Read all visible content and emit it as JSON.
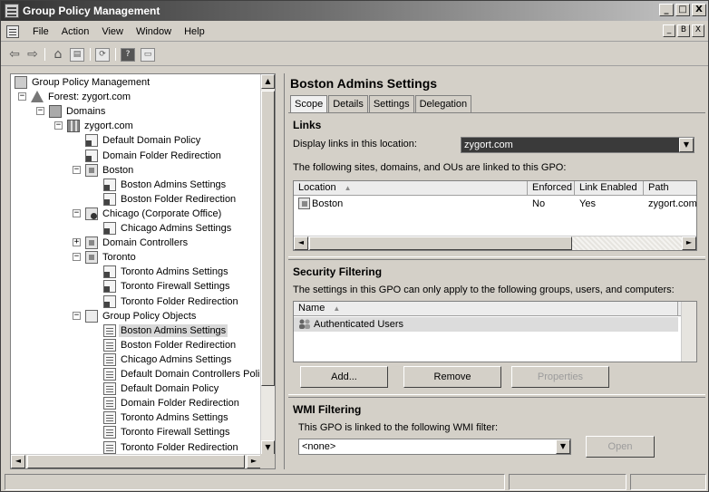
{
  "window": {
    "title": "Group Policy Management",
    "controls": [
      "_",
      "□",
      "X"
    ]
  },
  "menubar": {
    "items": [
      "File",
      "Action",
      "View",
      "Window",
      "Help"
    ],
    "mdi_controls": [
      "_",
      "B",
      "X"
    ]
  },
  "toolbar": {
    "buttons": [
      {
        "name": "back-icon",
        "glyph": "⇦"
      },
      {
        "name": "forward-icon",
        "glyph": "⇨"
      },
      {
        "name": "up-folder-icon",
        "glyph": "⌂"
      },
      {
        "name": "show-hide-tree-icon",
        "glyph": "▤"
      },
      {
        "name": "refresh-icon",
        "glyph": "⟳"
      },
      {
        "name": "help-icon",
        "glyph": "?"
      },
      {
        "name": "properties-icon",
        "glyph": "▭"
      }
    ]
  },
  "tree": {
    "nodes": [
      {
        "label": "Group Policy Management",
        "icon": "gpm",
        "level": 0,
        "expander": ""
      },
      {
        "label": "Forest: zygort.com",
        "icon": "forest",
        "level": 1,
        "expander": "−"
      },
      {
        "label": "Domains",
        "icon": "domains",
        "level": 2,
        "expander": "−"
      },
      {
        "label": "zygort.com",
        "icon": "domain",
        "level": 3,
        "expander": "−"
      },
      {
        "label": "Default Domain Policy",
        "icon": "link",
        "level": 4,
        "expander": ""
      },
      {
        "label": "Domain Folder Redirection",
        "icon": "link",
        "level": 4,
        "expander": ""
      },
      {
        "label": "Boston",
        "icon": "ou",
        "level": 4,
        "expander": "−"
      },
      {
        "label": "Boston Admins Settings",
        "icon": "link",
        "level": 5,
        "expander": ""
      },
      {
        "label": "Boston Folder Redirection",
        "icon": "link",
        "level": 5,
        "expander": ""
      },
      {
        "label": "Chicago (Corporate Office)",
        "icon": "ou-warn",
        "level": 4,
        "expander": "−"
      },
      {
        "label": "Chicago Admins Settings",
        "icon": "link",
        "level": 5,
        "expander": ""
      },
      {
        "label": "Domain Controllers",
        "icon": "ou",
        "level": 4,
        "expander": "+"
      },
      {
        "label": "Toronto",
        "icon": "ou",
        "level": 4,
        "expander": "−"
      },
      {
        "label": "Toronto Admins Settings",
        "icon": "link",
        "level": 5,
        "expander": ""
      },
      {
        "label": "Toronto Firewall Settings",
        "icon": "link",
        "level": 5,
        "expander": ""
      },
      {
        "label": "Toronto Folder Redirection",
        "icon": "link",
        "level": 5,
        "expander": ""
      },
      {
        "label": "Group Policy Objects",
        "icon": "gpos",
        "level": 4,
        "expander": "−"
      },
      {
        "label": "Boston Admins Settings",
        "icon": "gpo",
        "level": 5,
        "expander": "",
        "selected": true
      },
      {
        "label": "Boston Folder Redirection",
        "icon": "gpo",
        "level": 5,
        "expander": ""
      },
      {
        "label": "Chicago Admins Settings",
        "icon": "gpo",
        "level": 5,
        "expander": ""
      },
      {
        "label": "Default Domain Controllers Polic",
        "icon": "gpo",
        "level": 5,
        "expander": ""
      },
      {
        "label": "Default Domain Policy",
        "icon": "gpo",
        "level": 5,
        "expander": ""
      },
      {
        "label": "Domain Folder Redirection",
        "icon": "gpo",
        "level": 5,
        "expander": ""
      },
      {
        "label": "Toronto Admins Settings",
        "icon": "gpo",
        "level": 5,
        "expander": ""
      },
      {
        "label": "Toronto Firewall Settings",
        "icon": "gpo",
        "level": 5,
        "expander": ""
      },
      {
        "label": "Toronto Folder Redirection",
        "icon": "gpo",
        "level": 5,
        "expander": ""
      }
    ]
  },
  "details": {
    "title": "Boston Admins Settings",
    "tabs": [
      "Scope",
      "Details",
      "Settings",
      "Delegation"
    ],
    "active_tab": "Scope",
    "links": {
      "heading": "Links",
      "display_label": "Display links in this location:",
      "location_value": "zygort.com",
      "description": "The following sites, domains, and OUs are linked to this GPO:",
      "columns": [
        "Location",
        "Enforced",
        "Link Enabled",
        "Path"
      ],
      "rows": [
        {
          "location": "Boston",
          "enforced": "No",
          "link_enabled": "Yes",
          "path": "zygort.com"
        }
      ]
    },
    "security": {
      "heading": "Security Filtering",
      "description": "The settings in this GPO can only apply to the following groups, users, and computers:",
      "columns": [
        "Name"
      ],
      "rows": [
        {
          "name": "Authenticated Users"
        }
      ],
      "buttons": {
        "add": "Add...",
        "remove": "Remove",
        "properties": "Properties"
      }
    },
    "wmi": {
      "heading": "WMI Filtering",
      "description": "This GPO is linked to the following WMI filter:",
      "filter_value": "<none>",
      "open_label": "Open"
    }
  },
  "sort_glyph": "▲",
  "scroll_glyphs": {
    "up": "▲",
    "down": "▼",
    "left": "◄",
    "right": "►",
    "dropdown": "▼"
  }
}
